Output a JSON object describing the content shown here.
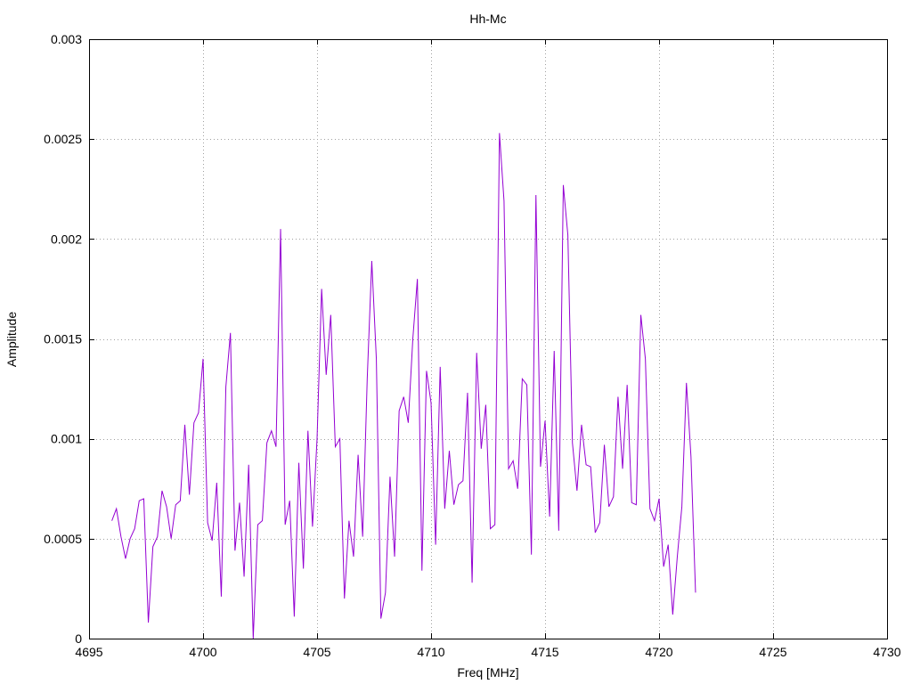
{
  "chart_data": {
    "type": "line",
    "title": "Hh-Mc",
    "xlabel": "Freq [MHz]",
    "ylabel": "Amplitude",
    "xlim": [
      4695,
      4730
    ],
    "ylim": [
      0,
      0.003
    ],
    "x_ticks": [
      4695,
      4700,
      4705,
      4710,
      4715,
      4720,
      4725,
      4730
    ],
    "x_tick_labels": [
      "4695",
      "4700",
      "4705",
      "4710",
      "4715",
      "4720",
      "4725",
      "4730"
    ],
    "y_ticks": [
      0,
      0.0005,
      0.001,
      0.0015,
      0.002,
      0.0025,
      0.003
    ],
    "y_tick_labels": [
      "0",
      "0.0005",
      "0.001",
      "0.0015",
      "0.002",
      "0.0025",
      "0.003"
    ],
    "grid": true,
    "legend": "none",
    "series": [
      {
        "color": "#9400d3",
        "x_start": 4696.0,
        "x_step": 0.2,
        "values": [
          0.00059,
          0.00065,
          0.00051,
          0.0004,
          0.0005,
          0.00055,
          0.00069,
          0.0007,
          8e-05,
          0.00046,
          0.00051,
          0.00074,
          0.00066,
          0.0005,
          0.00067,
          0.00069,
          0.00107,
          0.00072,
          0.00108,
          0.00113,
          0.0014,
          0.00058,
          0.00049,
          0.00078,
          0.00021,
          0.00126,
          0.00153,
          0.00044,
          0.00068,
          0.00031,
          0.00087,
          0.0,
          0.00057,
          0.00059,
          0.00098,
          0.00104,
          0.00096,
          0.00205,
          0.00057,
          0.00069,
          0.00011,
          0.00088,
          0.00035,
          0.00104,
          0.00056,
          0.001,
          0.00175,
          0.00132,
          0.00162,
          0.00096,
          0.001,
          0.0002,
          0.00059,
          0.00041,
          0.00092,
          0.00051,
          0.0013,
          0.00189,
          0.0014,
          0.0001,
          0.00023,
          0.00081,
          0.00041,
          0.00114,
          0.00121,
          0.00108,
          0.0015,
          0.0018,
          0.00034,
          0.00134,
          0.00118,
          0.00047,
          0.00136,
          0.00065,
          0.00094,
          0.00067,
          0.00077,
          0.00079,
          0.00123,
          0.00028,
          0.00143,
          0.00095,
          0.00117,
          0.00055,
          0.00057,
          0.00253,
          0.00219,
          0.00085,
          0.00089,
          0.00075,
          0.0013,
          0.00127,
          0.00042,
          0.00222,
          0.00086,
          0.00109,
          0.00061,
          0.00144,
          0.00054,
          0.00227,
          0.00202,
          0.00098,
          0.00074,
          0.00107,
          0.00087,
          0.00086,
          0.00053,
          0.00058,
          0.00097,
          0.00066,
          0.00071,
          0.00121,
          0.00085,
          0.00127,
          0.00068,
          0.00067,
          0.00162,
          0.0014,
          0.00065,
          0.00059,
          0.0007,
          0.00036,
          0.00047,
          0.00012,
          0.00041,
          0.00066,
          0.00128,
          0.00091,
          0.00023
        ]
      }
    ]
  }
}
